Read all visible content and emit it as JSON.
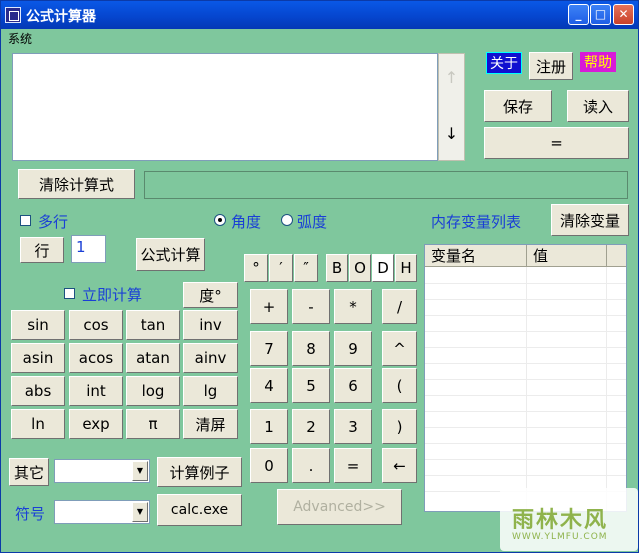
{
  "window": {
    "title": "公式计算器"
  },
  "menu": {
    "system": "系统"
  },
  "top_right": {
    "about": "关于",
    "register": "注册",
    "help": "帮助",
    "save": "保存",
    "load": "读入",
    "equals": "="
  },
  "expression": {
    "clear_label": "清除计算式",
    "result_value": ""
  },
  "scroll": {
    "up": "↑",
    "down": "↓"
  },
  "options": {
    "multiline": "多行",
    "degree": "角度",
    "radian": "弧度",
    "row_label": "行",
    "row_value": "1",
    "formula_calc": "公式计算",
    "instant_calc": "立即计算",
    "degree_button": "度°"
  },
  "memory": {
    "title": "内存变量列表",
    "clear_button": "清除变量",
    "columns": [
      "变量名",
      "值"
    ]
  },
  "units": [
    "°",
    "′",
    "″"
  ],
  "bases": [
    "B",
    "O",
    "D",
    "H"
  ],
  "func_rows": [
    [
      "sin",
      "cos",
      "tan",
      "inv"
    ],
    [
      "asin",
      "acos",
      "atan",
      "ainv"
    ],
    [
      "abs",
      "int",
      "log",
      "lg"
    ],
    [
      "ln",
      "exp",
      "π",
      "清屏"
    ]
  ],
  "keypad_rows": [
    [
      "+",
      "-",
      "*",
      "/"
    ],
    [
      "7",
      "8",
      "9",
      "^"
    ],
    [
      "4",
      "5",
      "6",
      "("
    ],
    [
      "1",
      "2",
      "3",
      ")"
    ],
    [
      "0",
      ".",
      "=",
      "←"
    ]
  ],
  "bottom": {
    "other_label": "其它",
    "examples_button": "计算例子",
    "symbol_label": "符号",
    "calc_exe": "calc.exe",
    "advanced": "Advanced>>"
  },
  "watermark": {
    "text": "雨林木风",
    "sub": "WWW.YLMFU.COM"
  },
  "colors": {
    "bg": "#7fc79d",
    "titlebar": "#0546cf",
    "label": "#1a3fd6"
  }
}
